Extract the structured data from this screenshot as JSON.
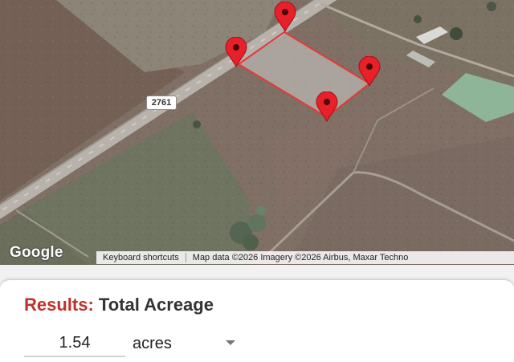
{
  "map": {
    "route_shield": "2761",
    "logo_text": "Google",
    "attribution": {
      "keyboard_shortcuts": "Keyboard shortcuts",
      "map_data": "Map data ©2026 Imagery ©2026 Airbus, Maxar Techno"
    },
    "pins": [
      "marker-pin",
      "marker-pin",
      "marker-pin",
      "marker-pin"
    ],
    "colors": {
      "polygon_stroke": "#e53935",
      "pin": "#e8202a"
    }
  },
  "results": {
    "title_prefix": "Results:",
    "title_rest": "Total Acreage",
    "value": "1.54",
    "unit": "acres",
    "colors": {
      "prefix": "#c0302c"
    }
  }
}
